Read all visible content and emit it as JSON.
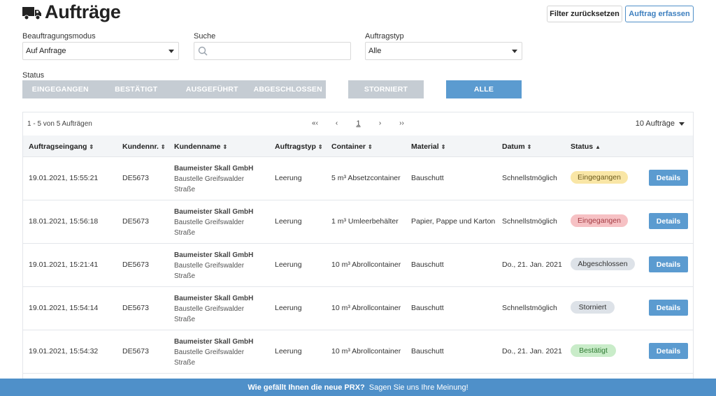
{
  "header": {
    "title": "Aufträge",
    "reset_label": "Filter zurücksetzen",
    "create_label": "Auftrag erfassen"
  },
  "filters": {
    "mode_label": "Beauftragungsmodus",
    "mode_value": "Auf Anfrage",
    "search_label": "Suche",
    "search_value": "",
    "type_label": "Auftragstyp",
    "type_value": "Alle",
    "status_label": "Status",
    "status_buttons": [
      "EINGEGANGEN",
      "BESTÄTIGT",
      "AUSGEFÜHRT",
      "ABGESCHLOSSEN"
    ],
    "storniert_label": "STORNIERT",
    "alle_label": "ALLE"
  },
  "pagination": {
    "count_text": "1 - 5 von 5 Aufträgen",
    "first": "«‹",
    "prev": "‹",
    "current": "1",
    "next": "›",
    "last": "››",
    "per_page": "10 Aufträge"
  },
  "table": {
    "columns": [
      "Auftragseingang",
      "Kundennr.",
      "Kundenname",
      "Auftragstyp",
      "Container",
      "Material",
      "Datum",
      "Status"
    ],
    "rows": [
      {
        "eingang": "19.01.2021, 15:55:21",
        "kundennr": "DE5673",
        "kunde": "Baumeister Skall GmbH",
        "baustelle1": "Baustelle Greifswalder",
        "baustelle2": "Straße",
        "typ": "Leerung",
        "container": "5 m³ Absetzcontainer",
        "material": "Bauschutt",
        "datum": "Schnellstmöglich",
        "status": "Eingegangen",
        "details": "Details"
      },
      {
        "eingang": "18.01.2021, 15:56:18",
        "kundennr": "DE5673",
        "kunde": "Baumeister Skall GmbH",
        "baustelle1": "Baustelle Greifswalder",
        "baustelle2": "Straße",
        "typ": "Leerung",
        "container": "1 m³ Umleerbehälter",
        "material": "Papier, Pappe und Karton",
        "datum": "Schnellstmöglich",
        "status": "Eingegangen",
        "details": "Details"
      },
      {
        "eingang": "19.01.2021, 15:21:41",
        "kundennr": "DE5673",
        "kunde": "Baumeister Skall GmbH",
        "baustelle1": "Baustelle Greifswalder",
        "baustelle2": "Straße",
        "typ": "Leerung",
        "container": "10 m³ Abrollcontainer",
        "material": "Bauschutt",
        "datum": "Do., 21. Jan. 2021",
        "status": "Abgeschlossen",
        "details": "Details"
      },
      {
        "eingang": "19.01.2021, 15:54:14",
        "kundennr": "DE5673",
        "kunde": "Baumeister Skall GmbH",
        "baustelle1": "Baustelle Greifswalder",
        "baustelle2": "Straße",
        "typ": "Leerung",
        "container": "10 m³ Abrollcontainer",
        "material": "Bauschutt",
        "datum": "Schnellstmöglich",
        "status": "Storniert",
        "details": "Details"
      },
      {
        "eingang": "19.01.2021, 15:54:32",
        "kundennr": "DE5673",
        "kunde": "Baumeister Skall GmbH",
        "baustelle1": "Baustelle Greifswalder",
        "baustelle2": "Straße",
        "typ": "Leerung",
        "container": "10 m³ Abrollcontainer",
        "material": "Bauschutt",
        "datum": "Do., 21. Jan. 2021",
        "status": "Bestätigt",
        "details": "Details"
      }
    ]
  },
  "badge_colors": {
    "yellow": {
      "bg": "#f9e6a6",
      "fg": "#6b5a1c"
    },
    "red": {
      "bg": "#f6c1c4",
      "fg": "#a33b43"
    },
    "grey": {
      "bg": "#dde2e8",
      "fg": "#333333"
    },
    "green": {
      "bg": "#c9ecc9",
      "fg": "#2f7a33"
    }
  },
  "row_badges": [
    "yellow",
    "red",
    "grey",
    "grey",
    "green"
  ],
  "feedback": {
    "question": "Wie gefällt Ihnen die neue PRX?",
    "action": "Sagen Sie uns Ihre Meinung!"
  },
  "colors": {
    "accent": "#5b9bd0",
    "status_inactive": "#c5ccd3",
    "feedback_bar": "#4f90c9"
  }
}
